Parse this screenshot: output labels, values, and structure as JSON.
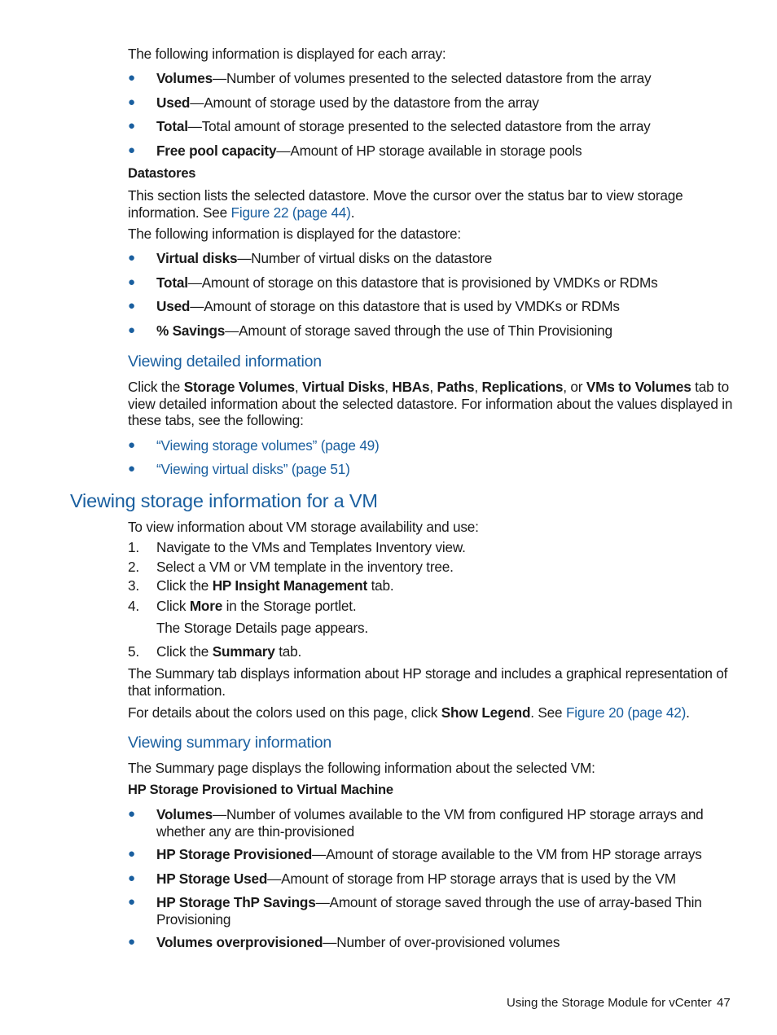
{
  "intro_array": "The following information is displayed for each array:",
  "array_items": [
    {
      "term": "Volumes",
      "desc": "—Number of volumes presented to the selected datastore from the array"
    },
    {
      "term": "Used",
      "desc": "—Amount of storage used by the datastore from the array"
    },
    {
      "term": "Total",
      "desc": "—Total amount of storage presented to the selected datastore from the array"
    },
    {
      "term": "Free pool capacity",
      "desc": "—Amount of HP storage available in storage pools"
    }
  ],
  "datastores": {
    "heading": "Datastores",
    "para_before": "This section lists the selected datastore. Move the cursor over the status bar to view storage information. See ",
    "para_link": "Figure 22 (page 44)",
    "para_after": ".",
    "intro": "The following information is displayed for the datastore:",
    "items": [
      {
        "term": "Virtual disks",
        "desc": "—Number of virtual disks on the datastore"
      },
      {
        "term": "Total",
        "desc": "—Amount of storage on this datastore that is provisioned by VMDKs or RDMs"
      },
      {
        "term": "Used",
        "desc": "—Amount of storage on this datastore that is used by VMDKs or RDMs"
      },
      {
        "term": "% Savings",
        "desc": "—Amount of storage saved through the use of Thin Provisioning"
      }
    ]
  },
  "detailed": {
    "heading": "Viewing detailed information",
    "p_click": "Click the ",
    "tabs": [
      "Storage Volumes",
      "Virtual Disks",
      "HBAs",
      "Paths",
      "Replications",
      "VMs to Volumes"
    ],
    "sep": ", ",
    "sep_or": ", or ",
    "p_rest": " tab to view detailed information about the selected datastore. For information about the values displayed in these tabs, see the following:",
    "links": [
      "“Viewing storage volumes” (page 49)",
      "“Viewing virtual disks” (page 51)"
    ]
  },
  "vm_section": {
    "heading": "Viewing storage information for a VM",
    "intro": "To view information about VM storage availability and use:",
    "steps": [
      {
        "n": "1.",
        "pre": "Navigate to the VMs and Templates Inventory view.",
        "bold": "",
        "post": ""
      },
      {
        "n": "2.",
        "pre": "Select a VM or VM template in the inventory tree.",
        "bold": "",
        "post": ""
      },
      {
        "n": "3.",
        "pre": "Click the ",
        "bold": "HP Insight Management",
        "post": " tab."
      },
      {
        "n": "4.",
        "pre": "Click ",
        "bold": "More",
        "post": " in the Storage portlet."
      },
      {
        "n": "5.",
        "pre": "Click the ",
        "bold": "Summary",
        "post": " tab."
      }
    ],
    "step4_result": "The Storage Details page appears.",
    "summary_para": "The Summary tab displays information about HP storage and includes a graphical representation of that information.",
    "legend_pre": "For details about the colors used on this page, click ",
    "legend_bold": "Show Legend",
    "legend_mid": ". See ",
    "legend_link": "Figure 20 (page 42)",
    "legend_post": "."
  },
  "summary": {
    "heading": "Viewing summary information",
    "intro": "The Summary page displays the following information about the selected VM:",
    "subheading": "HP Storage Provisioned to Virtual Machine",
    "items": [
      {
        "term": "Volumes",
        "desc": "—Number of volumes available to the VM from configured HP storage arrays and whether any are thin-provisioned"
      },
      {
        "term": "HP Storage Provisioned",
        "desc": "—Amount of storage available to the VM from HP storage arrays"
      },
      {
        "term": "HP Storage Used",
        "desc": "—Amount of storage from HP storage arrays that is used by the VM"
      },
      {
        "term": "HP Storage ThP Savings",
        "desc": "—Amount of storage saved through the use of array-based Thin Provisioning"
      },
      {
        "term": "Volumes overprovisioned",
        "desc": "—Number of over-provisioned volumes"
      }
    ]
  },
  "footer": {
    "title": "Using the Storage Module for vCenter",
    "page": "47"
  },
  "colors": {
    "link": "#1a5f9f",
    "text": "#1a1a1a"
  }
}
